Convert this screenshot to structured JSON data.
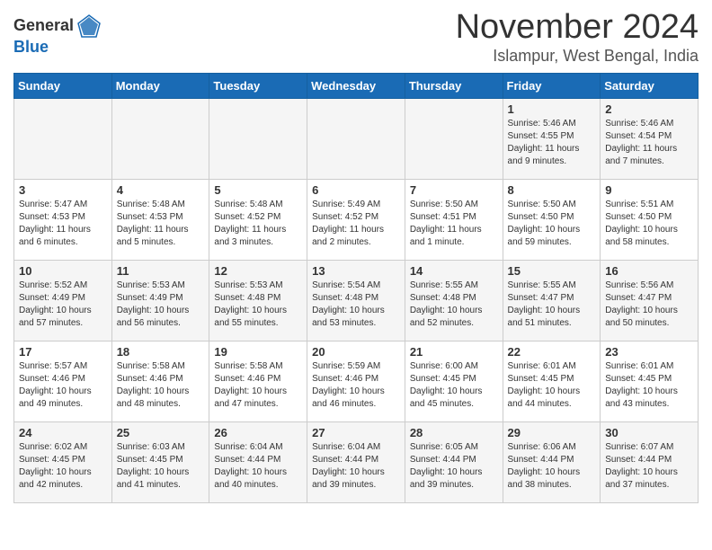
{
  "header": {
    "logo_general": "General",
    "logo_blue": "Blue",
    "month_title": "November 2024",
    "location": "Islampur, West Bengal, India"
  },
  "weekdays": [
    "Sunday",
    "Monday",
    "Tuesday",
    "Wednesday",
    "Thursday",
    "Friday",
    "Saturday"
  ],
  "weeks": [
    [
      {
        "day": "",
        "info": ""
      },
      {
        "day": "",
        "info": ""
      },
      {
        "day": "",
        "info": ""
      },
      {
        "day": "",
        "info": ""
      },
      {
        "day": "",
        "info": ""
      },
      {
        "day": "1",
        "info": "Sunrise: 5:46 AM\nSunset: 4:55 PM\nDaylight: 11 hours and 9 minutes."
      },
      {
        "day": "2",
        "info": "Sunrise: 5:46 AM\nSunset: 4:54 PM\nDaylight: 11 hours and 7 minutes."
      }
    ],
    [
      {
        "day": "3",
        "info": "Sunrise: 5:47 AM\nSunset: 4:53 PM\nDaylight: 11 hours and 6 minutes."
      },
      {
        "day": "4",
        "info": "Sunrise: 5:48 AM\nSunset: 4:53 PM\nDaylight: 11 hours and 5 minutes."
      },
      {
        "day": "5",
        "info": "Sunrise: 5:48 AM\nSunset: 4:52 PM\nDaylight: 11 hours and 3 minutes."
      },
      {
        "day": "6",
        "info": "Sunrise: 5:49 AM\nSunset: 4:52 PM\nDaylight: 11 hours and 2 minutes."
      },
      {
        "day": "7",
        "info": "Sunrise: 5:50 AM\nSunset: 4:51 PM\nDaylight: 11 hours and 1 minute."
      },
      {
        "day": "8",
        "info": "Sunrise: 5:50 AM\nSunset: 4:50 PM\nDaylight: 10 hours and 59 minutes."
      },
      {
        "day": "9",
        "info": "Sunrise: 5:51 AM\nSunset: 4:50 PM\nDaylight: 10 hours and 58 minutes."
      }
    ],
    [
      {
        "day": "10",
        "info": "Sunrise: 5:52 AM\nSunset: 4:49 PM\nDaylight: 10 hours and 57 minutes."
      },
      {
        "day": "11",
        "info": "Sunrise: 5:53 AM\nSunset: 4:49 PM\nDaylight: 10 hours and 56 minutes."
      },
      {
        "day": "12",
        "info": "Sunrise: 5:53 AM\nSunset: 4:48 PM\nDaylight: 10 hours and 55 minutes."
      },
      {
        "day": "13",
        "info": "Sunrise: 5:54 AM\nSunset: 4:48 PM\nDaylight: 10 hours and 53 minutes."
      },
      {
        "day": "14",
        "info": "Sunrise: 5:55 AM\nSunset: 4:48 PM\nDaylight: 10 hours and 52 minutes."
      },
      {
        "day": "15",
        "info": "Sunrise: 5:55 AM\nSunset: 4:47 PM\nDaylight: 10 hours and 51 minutes."
      },
      {
        "day": "16",
        "info": "Sunrise: 5:56 AM\nSunset: 4:47 PM\nDaylight: 10 hours and 50 minutes."
      }
    ],
    [
      {
        "day": "17",
        "info": "Sunrise: 5:57 AM\nSunset: 4:46 PM\nDaylight: 10 hours and 49 minutes."
      },
      {
        "day": "18",
        "info": "Sunrise: 5:58 AM\nSunset: 4:46 PM\nDaylight: 10 hours and 48 minutes."
      },
      {
        "day": "19",
        "info": "Sunrise: 5:58 AM\nSunset: 4:46 PM\nDaylight: 10 hours and 47 minutes."
      },
      {
        "day": "20",
        "info": "Sunrise: 5:59 AM\nSunset: 4:46 PM\nDaylight: 10 hours and 46 minutes."
      },
      {
        "day": "21",
        "info": "Sunrise: 6:00 AM\nSunset: 4:45 PM\nDaylight: 10 hours and 45 minutes."
      },
      {
        "day": "22",
        "info": "Sunrise: 6:01 AM\nSunset: 4:45 PM\nDaylight: 10 hours and 44 minutes."
      },
      {
        "day": "23",
        "info": "Sunrise: 6:01 AM\nSunset: 4:45 PM\nDaylight: 10 hours and 43 minutes."
      }
    ],
    [
      {
        "day": "24",
        "info": "Sunrise: 6:02 AM\nSunset: 4:45 PM\nDaylight: 10 hours and 42 minutes."
      },
      {
        "day": "25",
        "info": "Sunrise: 6:03 AM\nSunset: 4:45 PM\nDaylight: 10 hours and 41 minutes."
      },
      {
        "day": "26",
        "info": "Sunrise: 6:04 AM\nSunset: 4:44 PM\nDaylight: 10 hours and 40 minutes."
      },
      {
        "day": "27",
        "info": "Sunrise: 6:04 AM\nSunset: 4:44 PM\nDaylight: 10 hours and 39 minutes."
      },
      {
        "day": "28",
        "info": "Sunrise: 6:05 AM\nSunset: 4:44 PM\nDaylight: 10 hours and 39 minutes."
      },
      {
        "day": "29",
        "info": "Sunrise: 6:06 AM\nSunset: 4:44 PM\nDaylight: 10 hours and 38 minutes."
      },
      {
        "day": "30",
        "info": "Sunrise: 6:07 AM\nSunset: 4:44 PM\nDaylight: 10 hours and 37 minutes."
      }
    ]
  ]
}
